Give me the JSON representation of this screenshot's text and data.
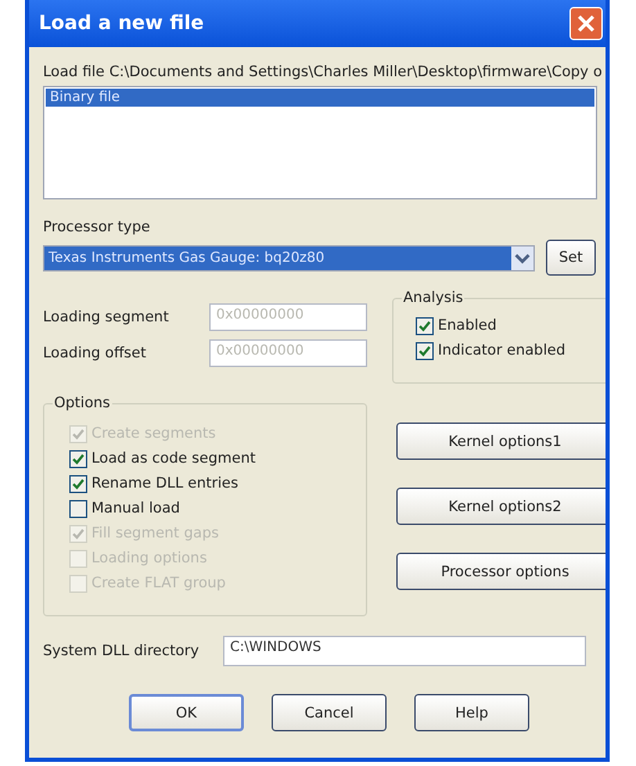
{
  "window": {
    "title": "Load a new file"
  },
  "load_file": {
    "label": "Load file C:\\Documents and Settings\\Charles Miller\\Desktop\\firmware\\Copy o",
    "items": [
      {
        "label": "Binary file",
        "selected": true
      }
    ]
  },
  "processor": {
    "label": "Processor type",
    "value": "Texas Instruments Gas Gauge: bq20z80",
    "set_button": "Set"
  },
  "loading_fields": [
    {
      "label": "Loading segment",
      "value": "0x00000000",
      "disabled": true
    },
    {
      "label": "Loading offset",
      "value": "0x00000000",
      "disabled": true
    }
  ],
  "analysis": {
    "title": "Analysis",
    "options": [
      {
        "label": "Enabled",
        "checked": true,
        "disabled": false
      },
      {
        "label": "Indicator enabled",
        "checked": true,
        "disabled": false
      }
    ]
  },
  "options": {
    "title": "Options",
    "items": [
      {
        "label": "Create segments",
        "checked": true,
        "disabled": true
      },
      {
        "label": "Load as code segment",
        "checked": true,
        "disabled": false
      },
      {
        "label": "Rename DLL entries",
        "checked": true,
        "disabled": false
      },
      {
        "label": "Manual load",
        "checked": false,
        "disabled": false
      },
      {
        "label": "Fill segment gaps",
        "checked": true,
        "disabled": true
      },
      {
        "label": "Loading options",
        "checked": false,
        "disabled": true
      },
      {
        "label": "Create FLAT group",
        "checked": false,
        "disabled": true
      }
    ]
  },
  "side_buttons": [
    "Kernel options1",
    "Kernel options2",
    "Processor options"
  ],
  "dll_directory": {
    "label": "System DLL directory",
    "value": "C:\\WINDOWS"
  },
  "buttons": [
    "OK",
    "Cancel",
    "Help"
  ]
}
